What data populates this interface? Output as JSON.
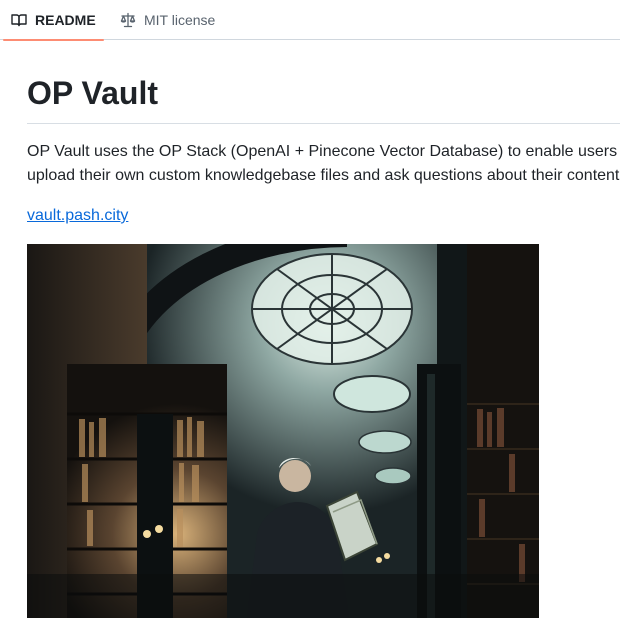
{
  "tabs": [
    {
      "label": "README",
      "icon": "book-icon",
      "active": true
    },
    {
      "label": "MIT license",
      "icon": "law-icon",
      "active": false
    }
  ],
  "readme": {
    "title": "OP Vault",
    "description_lines": [
      "OP Vault uses the OP Stack (OpenAI + Pinecone Vector Database) to enable users",
      "upload their own custom knowledgebase files and ask questions about their content"
    ],
    "link_text": "vault.pash.city"
  },
  "colors": {
    "accent_underline": "#fd8c73",
    "link": "#0969da",
    "text": "#1f2328",
    "border": "#d0d7de"
  }
}
